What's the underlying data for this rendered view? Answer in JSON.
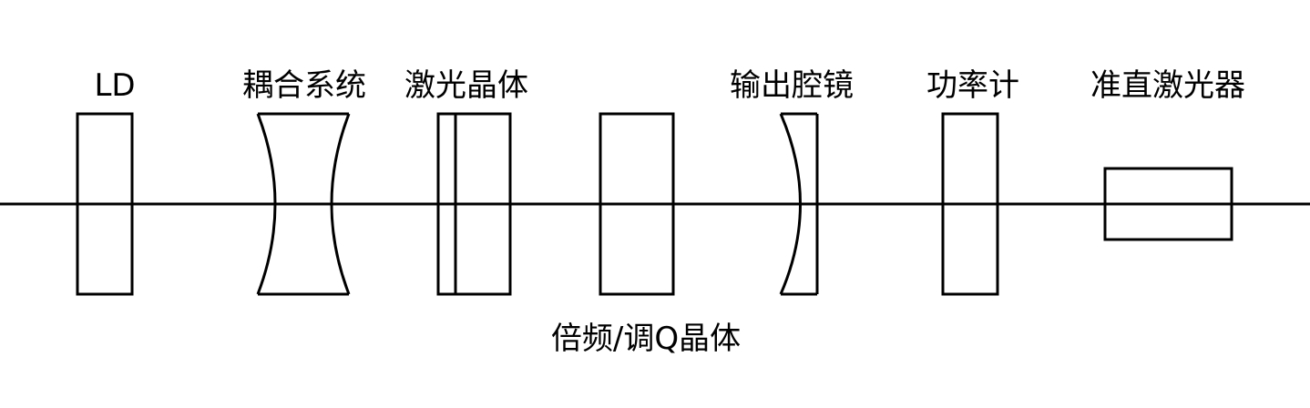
{
  "labels": {
    "ld": "LD",
    "coupling": "耦合系统",
    "laser_crystal": "激光晶体",
    "output_mirror": "输出腔镜",
    "power_meter": "功率计",
    "collimated_laser": "准直激光器",
    "freq_q_crystal": "倍频/调Q晶体"
  },
  "colors": {
    "line": "#000000",
    "background": "#ffffff"
  }
}
